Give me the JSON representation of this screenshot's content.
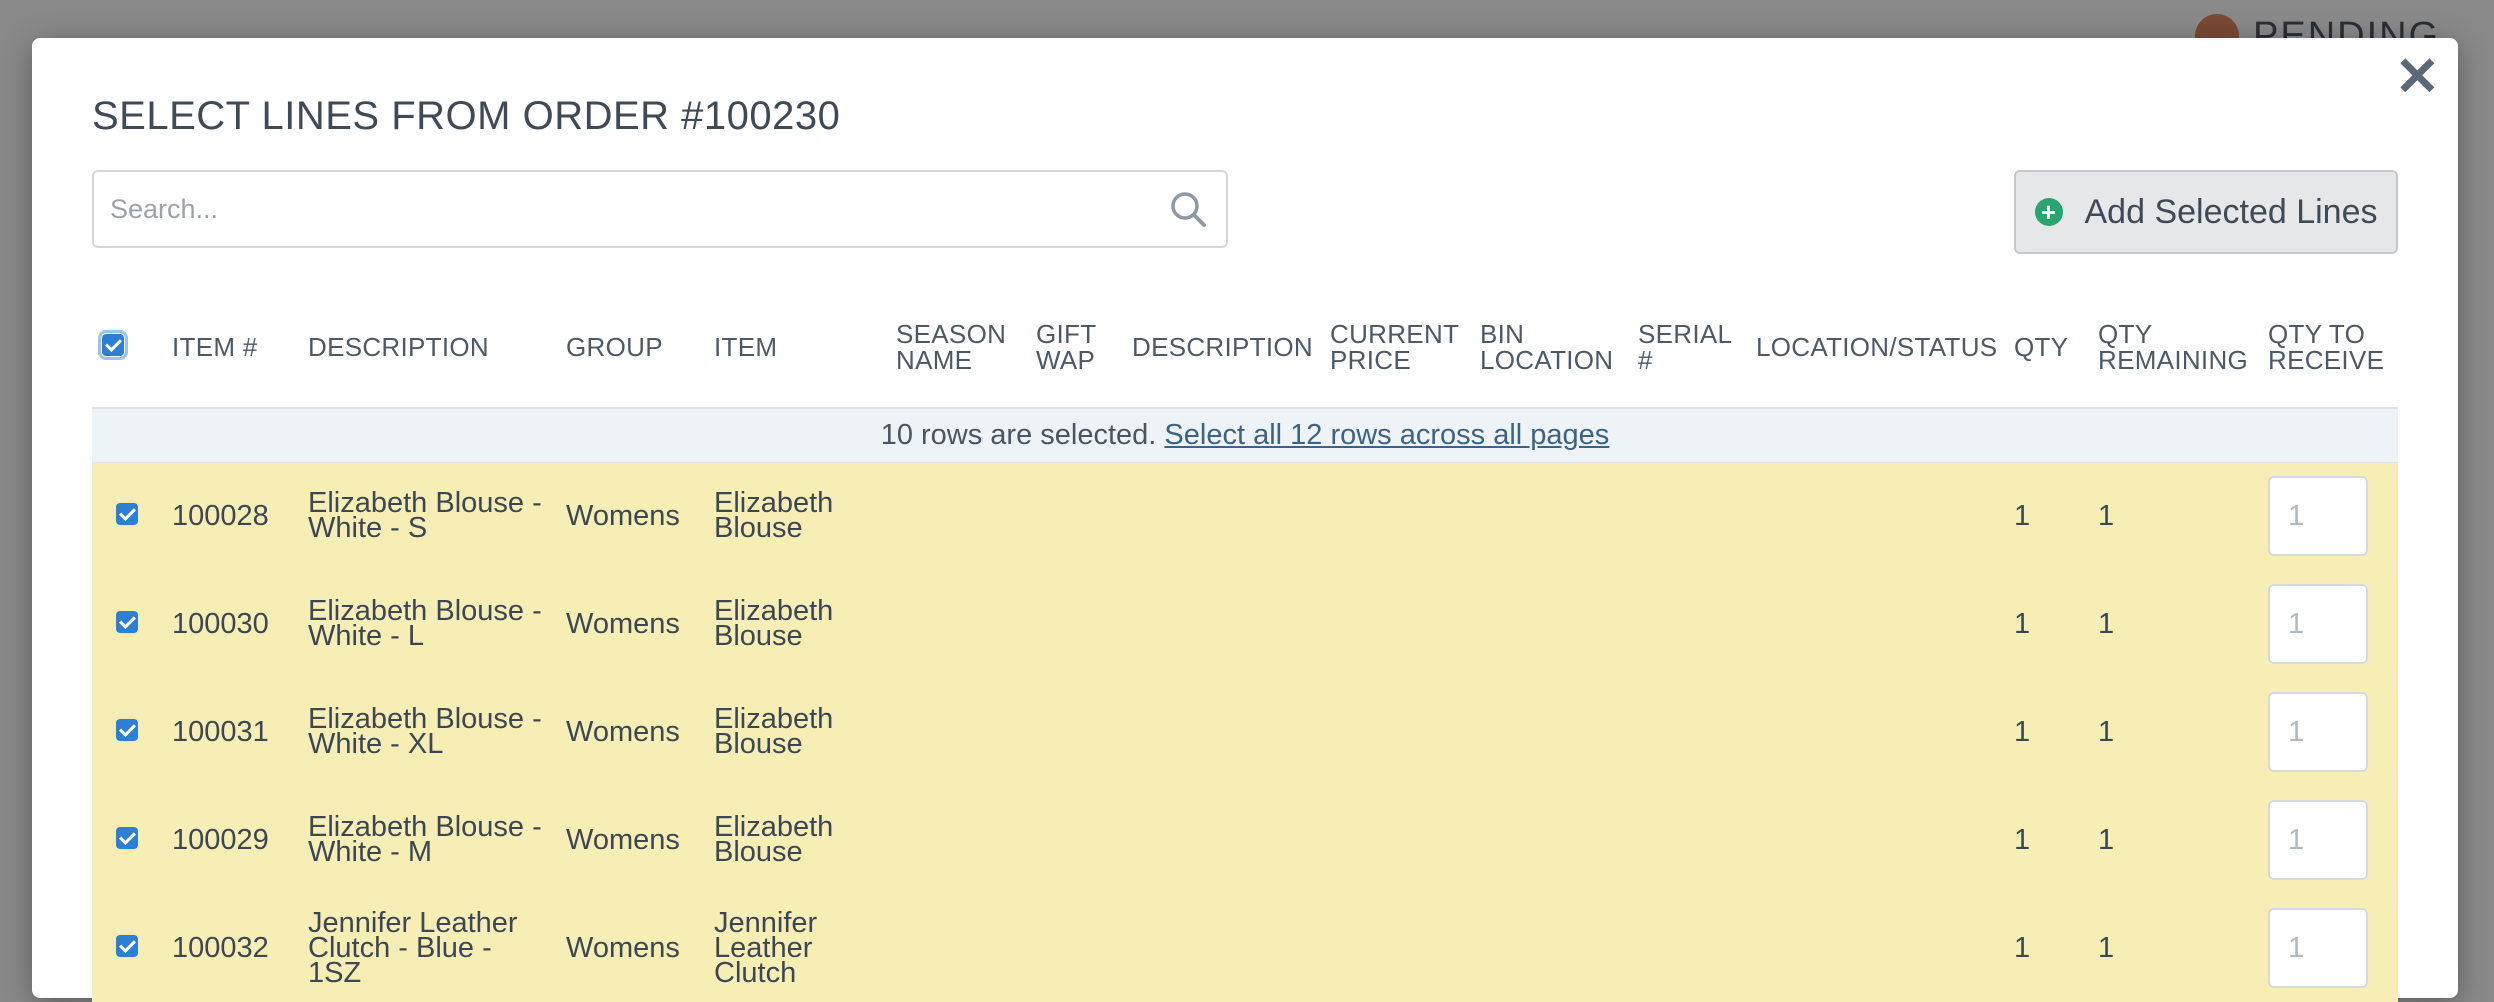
{
  "background": {
    "status_text": "PENDING"
  },
  "modal": {
    "title": "SELECT LINES FROM ORDER #100230",
    "close_icon": "close-icon",
    "search": {
      "placeholder": "Search...",
      "value": ""
    },
    "add_button_label": "Add Selected Lines"
  },
  "table": {
    "headers": {
      "item_no": "ITEM #",
      "description": "DESCRIPTION",
      "group": "GROUP",
      "item": "ITEM",
      "season_name": "SEASON NAME",
      "gift_wap": "GIFT WAP",
      "description2": "DESCRIPTION",
      "current_price": "CURRENT PRICE",
      "bin_location": "BIN LOCATION",
      "serial": "SERIAL #",
      "location_status": "LOCATION/STATUS",
      "qty": "QTY",
      "qty_remaining": "QTY REMAINING",
      "qty_to_receive": "QTY TO RECEIVE"
    },
    "selection_notice": {
      "text": "10 rows are selected.",
      "link": "Select all 12 rows across all pages"
    },
    "rows": [
      {
        "item_no": "100028",
        "description": "Elizabeth Blouse - White - S",
        "group": "Womens",
        "item": "Elizabeth Blouse",
        "qty": "1",
        "qty_remaining": "1",
        "qty_to_receive": "1"
      },
      {
        "item_no": "100030",
        "description": "Elizabeth Blouse - White - L",
        "group": "Womens",
        "item": "Elizabeth Blouse",
        "qty": "1",
        "qty_remaining": "1",
        "qty_to_receive": "1"
      },
      {
        "item_no": "100031",
        "description": "Elizabeth Blouse - White - XL",
        "group": "Womens",
        "item": "Elizabeth Blouse",
        "qty": "1",
        "qty_remaining": "1",
        "qty_to_receive": "1"
      },
      {
        "item_no": "100029",
        "description": "Elizabeth Blouse - White - M",
        "group": "Womens",
        "item": "Elizabeth Blouse",
        "qty": "1",
        "qty_remaining": "1",
        "qty_to_receive": "1"
      },
      {
        "item_no": "100032",
        "description": "Jennifer Leather Clutch - Blue - 1SZ",
        "group": "Womens",
        "item": "Jennifer Leather Clutch",
        "qty": "1",
        "qty_remaining": "1",
        "qty_to_receive": "1"
      }
    ]
  },
  "colors": {
    "selected_row_bg": "#f7eeb6",
    "checkbox_blue": "#2d7fd6",
    "add_icon_green": "#2ba36c"
  }
}
